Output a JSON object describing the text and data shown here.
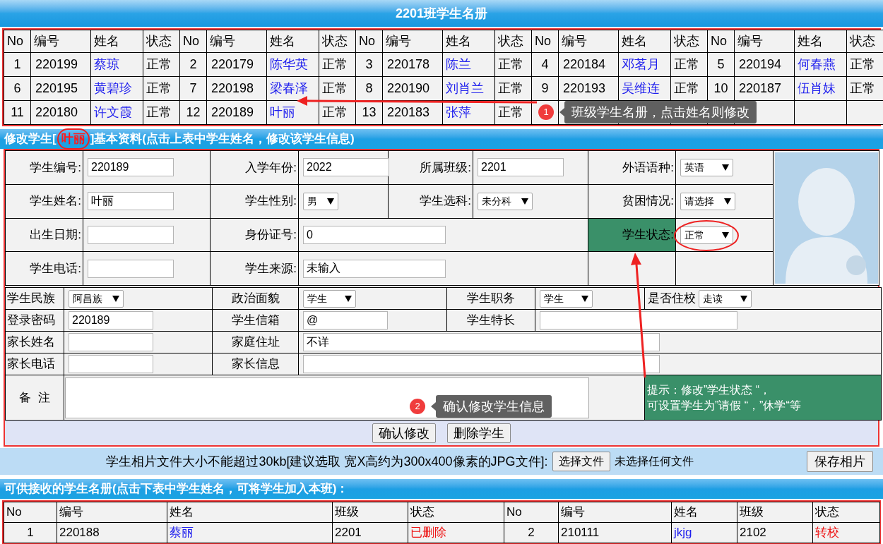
{
  "title": "2201班学生名册",
  "class_table": {
    "columns": [
      "No",
      "编号",
      "姓名",
      "状态",
      "No",
      "编号",
      "姓名",
      "状态",
      "No",
      "编号",
      "姓名",
      "状态",
      "No",
      "编号",
      "姓名",
      "状态",
      "No",
      "编号",
      "姓名",
      "状态"
    ],
    "students": [
      {
        "no": "1",
        "id": "220199",
        "name": "蔡琼",
        "status": "正常"
      },
      {
        "no": "2",
        "id": "220179",
        "name": "陈华英",
        "status": "正常"
      },
      {
        "no": "3",
        "id": "220178",
        "name": "陈兰",
        "status": "正常"
      },
      {
        "no": "4",
        "id": "220184",
        "name": "邓茗月",
        "status": "正常"
      },
      {
        "no": "5",
        "id": "220194",
        "name": "何春燕",
        "status": "正常"
      },
      {
        "no": "6",
        "id": "220195",
        "name": "黄碧珍",
        "status": "正常"
      },
      {
        "no": "7",
        "id": "220198",
        "name": "梁春泽",
        "status": "正常"
      },
      {
        "no": "8",
        "id": "220190",
        "name": "刘肖兰",
        "status": "正常"
      },
      {
        "no": "9",
        "id": "220193",
        "name": "吴维连",
        "status": "正常"
      },
      {
        "no": "10",
        "id": "220187",
        "name": "伍肖妹",
        "status": "正常"
      },
      {
        "no": "11",
        "id": "220180",
        "name": "许文霞",
        "status": "正常"
      },
      {
        "no": "12",
        "id": "220189",
        "name": "叶丽",
        "status": "正常"
      },
      {
        "no": "13",
        "id": "220183",
        "name": "张萍",
        "status": "正常"
      }
    ]
  },
  "edit_title": {
    "prefix": "修改学生[",
    "name": "叶丽",
    "suffix": "]基本资料(点击上表中学生姓名，修改该学生信息)"
  },
  "form": {
    "upper": [
      [
        {
          "label": "学生编号:",
          "kind": "input",
          "value": "220189",
          "highlighted": false
        },
        {
          "label": "入学年份:",
          "kind": "input",
          "value": "2022",
          "highlighted": false
        },
        {
          "label": "所属班级:",
          "kind": "input",
          "value": "2201",
          "highlighted": false
        },
        {
          "label": "外语语种:",
          "kind": "select",
          "value": "英语",
          "highlighted": false
        }
      ],
      [
        {
          "label": "学生姓名:",
          "kind": "input",
          "value": "叶丽",
          "highlighted": false
        },
        {
          "label": "学生性别:",
          "kind": "select",
          "value": "男",
          "highlighted": false
        },
        {
          "label": "学生选科:",
          "kind": "select",
          "value": "未分科",
          "highlighted": false
        },
        {
          "label": "贫困情况:",
          "kind": "select",
          "value": "请选择",
          "highlighted": false
        }
      ],
      [
        {
          "label": "出生日期:",
          "kind": "input",
          "highlighted": false
        },
        {
          "label": "身份证号:",
          "kind": "wide_input",
          "value": "0",
          "highlighted": false
        },
        {
          "label": "学生状态:",
          "kind": "select",
          "value": "正常",
          "highlighted": true
        }
      ],
      [
        {
          "label": "学生电话:",
          "kind": "input",
          "highlighted": false
        },
        {
          "label": "学生来源:",
          "kind": "wide_input",
          "value": "未输入",
          "highlighted": false
        }
      ]
    ],
    "lower": [
      [
        {
          "label": "学生民族",
          "kind": "select",
          "value": "阿昌族"
        },
        {
          "label": "政治面貌",
          "kind": "select",
          "value": "学生"
        },
        {
          "label": "学生职务",
          "kind": "select",
          "value": "学生"
        },
        {
          "label": "是否住校",
          "kind": "inline_select",
          "value": "走读"
        }
      ],
      [
        {
          "label": "登录密码",
          "kind": "input",
          "value": "220189"
        },
        {
          "label": "学生信箱",
          "kind": "input",
          "value": "@"
        },
        {
          "label": "学生特长",
          "kind": "wide_input"
        }
      ],
      [
        {
          "label": "家长姓名",
          "kind": "input"
        },
        {
          "label": "家庭住址",
          "kind": "wide_input",
          "value": "不详"
        }
      ],
      [
        {
          "label": "家长电话",
          "kind": "input"
        },
        {
          "label": "家长信息",
          "kind": "wide_input"
        }
      ]
    ],
    "remark": {
      "label": "备  注"
    },
    "hint": [
      "提示：修改”学生状态 “，",
      "可设置学生为”请假 “，”休学“等"
    ],
    "buttons": [
      "确认修改",
      "删除学生"
    ]
  },
  "photo_bar": {
    "note": "学生相片文件大小不能超过30kb[建议选取 宽X高约为300x400像素的JPG文件]:",
    "choose_button": "选择文件",
    "file_status": "未选择任何文件",
    "save_button": "保存相片"
  },
  "receive_title": "可供接收的学生名册(点击下表中学生姓名，可将学生加入本班)：",
  "receive_table": {
    "columns": [
      "No",
      "编号",
      "姓名",
      "班级",
      "状态",
      "No",
      "编号",
      "姓名",
      "班级",
      "状态"
    ],
    "students": [
      {
        "no": "1",
        "id": "220188",
        "name": "蔡丽",
        "class": "2201",
        "status": "已删除"
      },
      {
        "no": "2",
        "id": "210111",
        "name": "jkjg",
        "class": "2102",
        "status": "转校"
      }
    ]
  },
  "annotations": [
    {
      "badge": "1",
      "text": "班级学生名册，点击姓名则修改"
    },
    {
      "badge": "2",
      "text": "确认修改学生信息"
    }
  ]
}
